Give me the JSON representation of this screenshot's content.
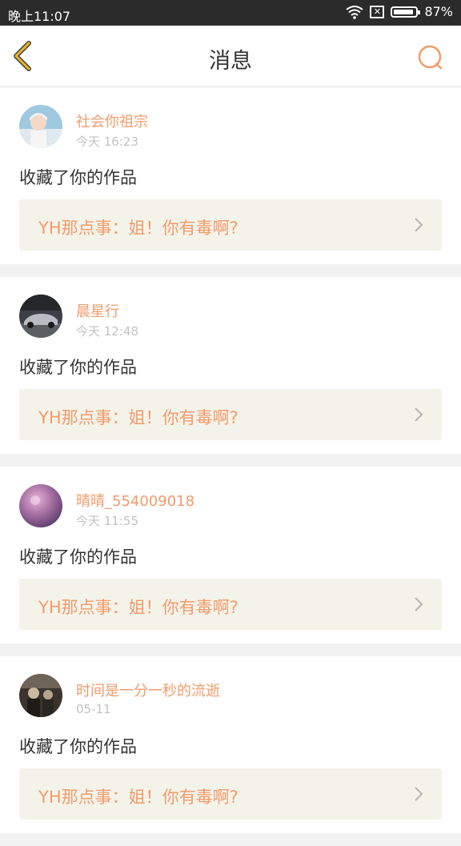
{
  "status_bar": {
    "time": "晚上11:07",
    "battery": "87%",
    "icons": [
      "wifi-icon",
      "sim-off-icon",
      "battery-icon"
    ]
  },
  "header": {
    "title": "消息",
    "back_icon": "chevron-left-icon",
    "search_icon": "search-icon"
  },
  "colors": {
    "accent": "#f29b6b",
    "back_arrow": "#e8b820",
    "card_bg": "#f4f3ea"
  },
  "messages": [
    {
      "username": "社会你祖宗",
      "time": "今天 16:23",
      "action": "收藏了你的作品",
      "work": "YH那点事：姐！你有毒啊?"
    },
    {
      "username": "晨星行",
      "time": "今天 12:48",
      "action": "收藏了你的作品",
      "work": "YH那点事：姐！你有毒啊?"
    },
    {
      "username": "晴晴_554009018",
      "time": "今天 11:55",
      "action": "收藏了你的作品",
      "work": "YH那点事：姐！你有毒啊?"
    },
    {
      "username": "时间是一分一秒的流逝",
      "time": "05-11",
      "action": "收藏了你的作品",
      "work": "YH那点事：姐！你有毒啊?"
    }
  ]
}
